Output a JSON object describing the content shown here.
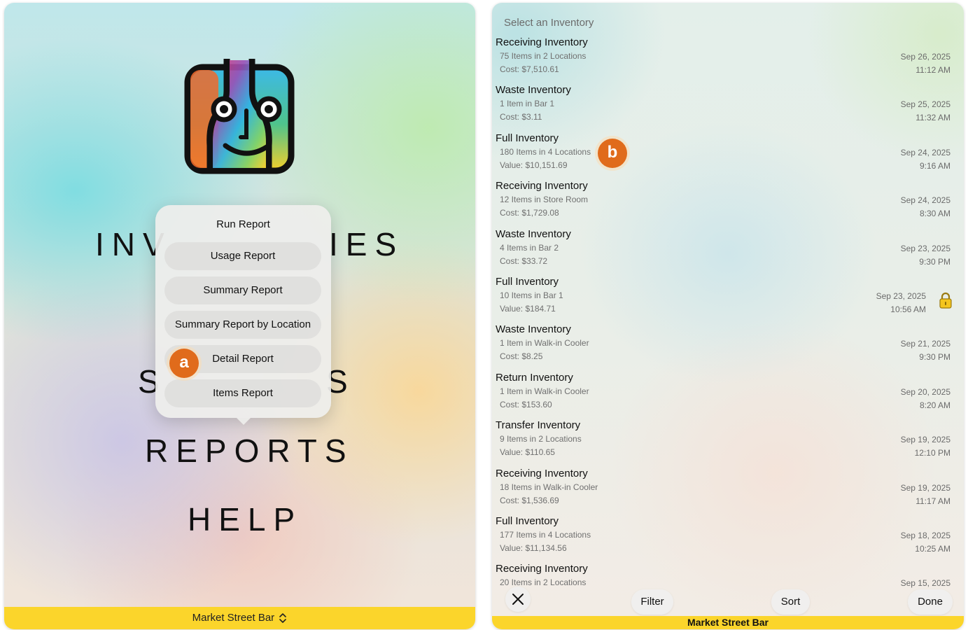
{
  "left_panel": {
    "menu_words": [
      "INV",
      "IES",
      "S",
      "S",
      "REPORTS",
      "HELP"
    ],
    "popover": {
      "title": "Run Report",
      "items": [
        "Usage Report",
        "Summary Report",
        "Summary Report by Location",
        "Detail Report",
        "Items Report"
      ]
    },
    "badge_a": "a",
    "footer_label": "Market Street Bar"
  },
  "right_panel": {
    "header": "Select an Inventory",
    "badge_b": "b",
    "inventories": [
      {
        "title": "Receiving Inventory",
        "sub": "75 Items in 2 Locations",
        "cost": "Cost: $7,510.61",
        "date": "Sep 26, 2025",
        "time": "11:12 AM"
      },
      {
        "title": "Waste Inventory",
        "sub": "1 Item in Bar 1",
        "cost": "Cost: $3.11",
        "date": "Sep 25, 2025",
        "time": "11:32 AM"
      },
      {
        "title": "Full Inventory",
        "sub": "180 Items in 4 Locations",
        "cost": "Value: $10,151.69",
        "date": "Sep 24, 2025",
        "time": "9:16 AM"
      },
      {
        "title": "Receiving Inventory",
        "sub": "12 Items in Store Room",
        "cost": "Cost: $1,729.08",
        "date": "Sep 24, 2025",
        "time": "8:30 AM"
      },
      {
        "title": "Waste Inventory",
        "sub": "4 Items in Bar 2",
        "cost": "Cost: $33.72",
        "date": "Sep 23, 2025",
        "time": "9:30 PM"
      },
      {
        "title": "Full Inventory",
        "sub": "10 Items in Bar 1",
        "cost": "Value: $184.71",
        "date": "Sep 23, 2025",
        "time": "10:56 AM",
        "locked": true
      },
      {
        "title": "Waste Inventory",
        "sub": "1 Item in Walk-in Cooler",
        "cost": "Cost: $8.25",
        "date": "Sep 21, 2025",
        "time": "9:30 PM"
      },
      {
        "title": "Return Inventory",
        "sub": "1 Item in Walk-in Cooler",
        "cost": "Cost: $153.60",
        "date": "Sep 20, 2025",
        "time": "8:20 AM"
      },
      {
        "title": "Transfer Inventory",
        "sub": "9 Items in 2 Locations",
        "cost": "Value: $110.65",
        "date": "Sep 19, 2025",
        "time": "12:10 PM"
      },
      {
        "title": "Receiving Inventory",
        "sub": "18 Items in Walk-in Cooler",
        "cost": "Cost: $1,536.69",
        "date": "Sep 19, 2025",
        "time": "11:17 AM"
      },
      {
        "title": "Full Inventory",
        "sub": "177 Items in 4 Locations",
        "cost": "Value: $11,134.56",
        "date": "Sep 18, 2025",
        "time": "10:25 AM"
      },
      {
        "title": "Receiving Inventory",
        "sub": "20 Items in 2 Locations",
        "cost": "",
        "date": "Sep 15, 2025",
        "time": ""
      }
    ],
    "toolbar": {
      "close_icon": "x-icon",
      "filter_label": "Filter",
      "sort_label": "Sort",
      "done_label": "Done"
    },
    "footer_label": "Market Street Bar"
  },
  "colors": {
    "footer_yellow": "#fbd52b",
    "badge_orange": "#e06b1b"
  }
}
